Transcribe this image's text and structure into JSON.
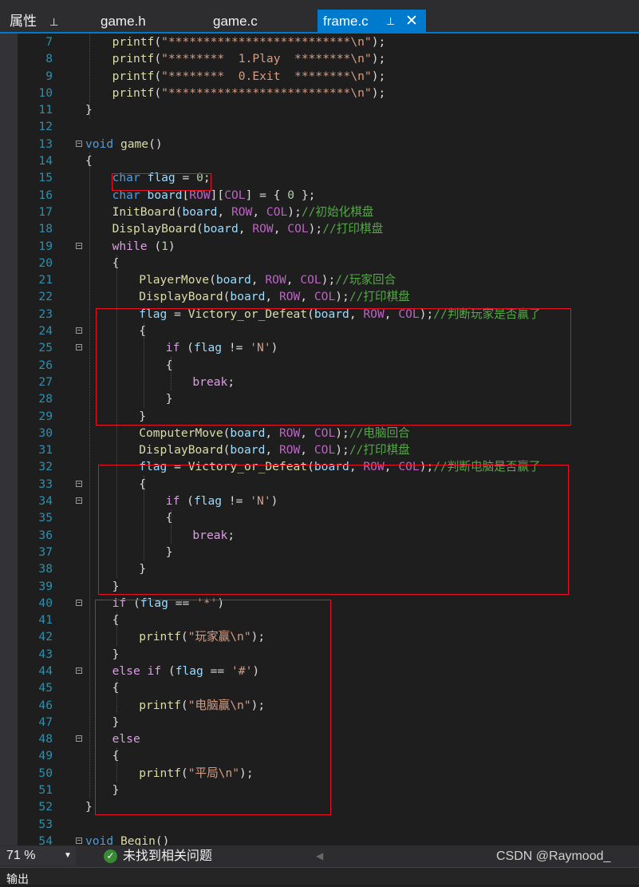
{
  "tabs": {
    "properties": "属性",
    "pin": "⊥",
    "game_h": "game.h",
    "game_c": "game.c",
    "frame_c": "frame.c",
    "close": "✕"
  },
  "code": [
    {
      "n": "7",
      "indent": 2,
      "t": [
        [
          "fn",
          "printf"
        ],
        [
          "p",
          "("
        ],
        [
          "s",
          "\"**************************\\n\""
        ],
        [
          "p",
          ");"
        ]
      ]
    },
    {
      "n": "8",
      "indent": 2,
      "t": [
        [
          "fn",
          "printf"
        ],
        [
          "p",
          "("
        ],
        [
          "s",
          "\"********  1.Play  ********\\n\""
        ],
        [
          "p",
          ");"
        ]
      ]
    },
    {
      "n": "9",
      "indent": 2,
      "t": [
        [
          "fn",
          "printf"
        ],
        [
          "p",
          "("
        ],
        [
          "s",
          "\"********  0.Exit  ********\\n\""
        ],
        [
          "p",
          ");"
        ]
      ]
    },
    {
      "n": "10",
      "indent": 2,
      "t": [
        [
          "fn",
          "printf"
        ],
        [
          "p",
          "("
        ],
        [
          "s",
          "\"**************************\\n\""
        ],
        [
          "p",
          ");"
        ]
      ]
    },
    {
      "n": "11",
      "indent": 0,
      "t": [
        [
          "p",
          "}"
        ]
      ]
    },
    {
      "n": "12",
      "indent": 0,
      "t": []
    },
    {
      "n": "13",
      "indent": 0,
      "fold": true,
      "t": [
        [
          "k",
          "void"
        ],
        [
          "p",
          " "
        ],
        [
          "fn",
          "game"
        ],
        [
          "p",
          "()"
        ]
      ]
    },
    {
      "n": "14",
      "indent": 0,
      "t": [
        [
          "p",
          "{"
        ]
      ]
    },
    {
      "n": "15",
      "indent": 2,
      "t": [
        [
          "k",
          "char"
        ],
        [
          "p",
          " "
        ],
        [
          "v",
          "flag"
        ],
        [
          "p",
          " = "
        ],
        [
          "n",
          "0"
        ],
        [
          "p",
          ";"
        ]
      ]
    },
    {
      "n": "16",
      "indent": 2,
      "t": [
        [
          "k",
          "char"
        ],
        [
          "p",
          " "
        ],
        [
          "v",
          "board"
        ],
        [
          "p",
          "["
        ],
        [
          "m",
          "ROW"
        ],
        [
          "p",
          "]["
        ],
        [
          "m",
          "COL"
        ],
        [
          "p",
          "] = { "
        ],
        [
          "n",
          "0"
        ],
        [
          "p",
          " };"
        ]
      ]
    },
    {
      "n": "17",
      "indent": 2,
      "t": [
        [
          "fn",
          "InitBoard"
        ],
        [
          "p",
          "("
        ],
        [
          "v",
          "board"
        ],
        [
          "p",
          ", "
        ],
        [
          "m",
          "ROW"
        ],
        [
          "p",
          ", "
        ],
        [
          "m",
          "COL"
        ],
        [
          "p",
          ");"
        ],
        [
          "c",
          "//初始化棋盘"
        ]
      ]
    },
    {
      "n": "18",
      "indent": 2,
      "t": [
        [
          "fn",
          "DisplayBoard"
        ],
        [
          "p",
          "("
        ],
        [
          "v",
          "board"
        ],
        [
          "p",
          ", "
        ],
        [
          "m",
          "ROW"
        ],
        [
          "p",
          ", "
        ],
        [
          "m",
          "COL"
        ],
        [
          "p",
          ");"
        ],
        [
          "c",
          "//打印棋盘"
        ]
      ]
    },
    {
      "n": "19",
      "indent": 2,
      "fold": true,
      "t": [
        [
          "k2",
          "while"
        ],
        [
          "p",
          " ("
        ],
        [
          "n",
          "1"
        ],
        [
          "p",
          ")"
        ]
      ]
    },
    {
      "n": "20",
      "indent": 2,
      "t": [
        [
          "p",
          "{"
        ]
      ]
    },
    {
      "n": "21",
      "indent": 4,
      "t": [
        [
          "fn",
          "PlayerMove"
        ],
        [
          "p",
          "("
        ],
        [
          "v",
          "board"
        ],
        [
          "p",
          ", "
        ],
        [
          "m",
          "ROW"
        ],
        [
          "p",
          ", "
        ],
        [
          "m",
          "COL"
        ],
        [
          "p",
          ");"
        ],
        [
          "c",
          "//玩家回合"
        ]
      ]
    },
    {
      "n": "22",
      "indent": 4,
      "t": [
        [
          "fn",
          "DisplayBoard"
        ],
        [
          "p",
          "("
        ],
        [
          "v",
          "board"
        ],
        [
          "p",
          ", "
        ],
        [
          "m",
          "ROW"
        ],
        [
          "p",
          ", "
        ],
        [
          "m",
          "COL"
        ],
        [
          "p",
          ");"
        ],
        [
          "c",
          "//打印棋盘"
        ]
      ]
    },
    {
      "n": "23",
      "indent": 4,
      "t": [
        [
          "v",
          "flag"
        ],
        [
          "p",
          " = "
        ],
        [
          "fn",
          "Victory_or_Defeat"
        ],
        [
          "p",
          "("
        ],
        [
          "v",
          "board"
        ],
        [
          "p",
          ", "
        ],
        [
          "m",
          "ROW"
        ],
        [
          "p",
          ", "
        ],
        [
          "m",
          "COL"
        ],
        [
          "p",
          ");"
        ],
        [
          "c",
          "//判断玩家是否赢了"
        ]
      ]
    },
    {
      "n": "24",
      "indent": 4,
      "fold": true,
      "t": [
        [
          "p",
          "{"
        ]
      ]
    },
    {
      "n": "25",
      "indent": 6,
      "fold": true,
      "t": [
        [
          "k2",
          "if"
        ],
        [
          "p",
          " ("
        ],
        [
          "v",
          "flag"
        ],
        [
          "p",
          " != "
        ],
        [
          "s",
          "'N'"
        ],
        [
          "p",
          ")"
        ]
      ]
    },
    {
      "n": "26",
      "indent": 6,
      "t": [
        [
          "p",
          "{"
        ]
      ]
    },
    {
      "n": "27",
      "indent": 8,
      "t": [
        [
          "k2",
          "break"
        ],
        [
          "p",
          ";"
        ]
      ]
    },
    {
      "n": "28",
      "indent": 6,
      "t": [
        [
          "p",
          "}"
        ]
      ]
    },
    {
      "n": "29",
      "indent": 4,
      "t": [
        [
          "p",
          "}"
        ]
      ]
    },
    {
      "n": "30",
      "indent": 4,
      "t": [
        [
          "fn",
          "ComputerMove"
        ],
        [
          "p",
          "("
        ],
        [
          "v",
          "board"
        ],
        [
          "p",
          ", "
        ],
        [
          "m",
          "ROW"
        ],
        [
          "p",
          ", "
        ],
        [
          "m",
          "COL"
        ],
        [
          "p",
          ");"
        ],
        [
          "c",
          "//电脑回合"
        ]
      ]
    },
    {
      "n": "31",
      "indent": 4,
      "t": [
        [
          "fn",
          "DisplayBoard"
        ],
        [
          "p",
          "("
        ],
        [
          "v",
          "board"
        ],
        [
          "p",
          ", "
        ],
        [
          "m",
          "ROW"
        ],
        [
          "p",
          ", "
        ],
        [
          "m",
          "COL"
        ],
        [
          "p",
          ");"
        ],
        [
          "c",
          "//打印棋盘"
        ]
      ]
    },
    {
      "n": "32",
      "indent": 4,
      "t": [
        [
          "v",
          "flag"
        ],
        [
          "p",
          " = "
        ],
        [
          "fn",
          "Victory_or_Defeat"
        ],
        [
          "p",
          "("
        ],
        [
          "v",
          "board"
        ],
        [
          "p",
          ", "
        ],
        [
          "m",
          "ROW"
        ],
        [
          "p",
          ", "
        ],
        [
          "m",
          "COL"
        ],
        [
          "p",
          ");"
        ],
        [
          "c",
          "//判断电脑是否赢了"
        ]
      ]
    },
    {
      "n": "33",
      "indent": 4,
      "fold": true,
      "t": [
        [
          "p",
          "{"
        ]
      ]
    },
    {
      "n": "34",
      "indent": 6,
      "fold": true,
      "t": [
        [
          "k2",
          "if"
        ],
        [
          "p",
          " ("
        ],
        [
          "v",
          "flag"
        ],
        [
          "p",
          " != "
        ],
        [
          "s",
          "'N'"
        ],
        [
          "p",
          ")"
        ]
      ]
    },
    {
      "n": "35",
      "indent": 6,
      "t": [
        [
          "p",
          "{"
        ]
      ]
    },
    {
      "n": "36",
      "indent": 8,
      "t": [
        [
          "k2",
          "break"
        ],
        [
          "p",
          ";"
        ]
      ]
    },
    {
      "n": "37",
      "indent": 6,
      "t": [
        [
          "p",
          "}"
        ]
      ]
    },
    {
      "n": "38",
      "indent": 4,
      "t": [
        [
          "p",
          "}"
        ]
      ]
    },
    {
      "n": "39",
      "indent": 2,
      "t": [
        [
          "p",
          "}"
        ]
      ]
    },
    {
      "n": "40",
      "indent": 2,
      "fold": true,
      "t": [
        [
          "k2",
          "if"
        ],
        [
          "p",
          " ("
        ],
        [
          "v",
          "flag"
        ],
        [
          "p",
          " == "
        ],
        [
          "s",
          "'*'"
        ],
        [
          "p",
          ")"
        ]
      ]
    },
    {
      "n": "41",
      "indent": 2,
      "t": [
        [
          "p",
          "{"
        ]
      ]
    },
    {
      "n": "42",
      "indent": 4,
      "t": [
        [
          "fn",
          "printf"
        ],
        [
          "p",
          "("
        ],
        [
          "s",
          "\"玩家赢\\n\""
        ],
        [
          "p",
          ");"
        ]
      ]
    },
    {
      "n": "43",
      "indent": 2,
      "t": [
        [
          "p",
          "}"
        ]
      ]
    },
    {
      "n": "44",
      "indent": 2,
      "fold": true,
      "t": [
        [
          "k2",
          "else if"
        ],
        [
          "p",
          " ("
        ],
        [
          "v",
          "flag"
        ],
        [
          "p",
          " == "
        ],
        [
          "s",
          "'#'"
        ],
        [
          "p",
          ")"
        ]
      ]
    },
    {
      "n": "45",
      "indent": 2,
      "t": [
        [
          "p",
          "{"
        ]
      ]
    },
    {
      "n": "46",
      "indent": 4,
      "t": [
        [
          "fn",
          "printf"
        ],
        [
          "p",
          "("
        ],
        [
          "s",
          "\"电脑赢\\n\""
        ],
        [
          "p",
          ");"
        ]
      ]
    },
    {
      "n": "47",
      "indent": 2,
      "t": [
        [
          "p",
          "}"
        ]
      ]
    },
    {
      "n": "48",
      "indent": 2,
      "fold": true,
      "t": [
        [
          "k2",
          "else"
        ]
      ]
    },
    {
      "n": "49",
      "indent": 2,
      "t": [
        [
          "p",
          "{"
        ]
      ]
    },
    {
      "n": "50",
      "indent": 4,
      "t": [
        [
          "fn",
          "printf"
        ],
        [
          "p",
          "("
        ],
        [
          "s",
          "\"平局\\n\""
        ],
        [
          "p",
          ");"
        ]
      ]
    },
    {
      "n": "51",
      "indent": 2,
      "t": [
        [
          "p",
          "}"
        ]
      ]
    },
    {
      "n": "52",
      "indent": 0,
      "t": [
        [
          "p",
          "}"
        ]
      ]
    },
    {
      "n": "53",
      "indent": 0,
      "t": []
    },
    {
      "n": "54",
      "indent": 0,
      "fold": true,
      "t": [
        [
          "k",
          "void"
        ],
        [
          "p",
          " "
        ],
        [
          "fn",
          "Begin"
        ],
        [
          "p",
          "()"
        ]
      ]
    }
  ],
  "statusbar": {
    "zoom": "71 %",
    "zoom_arrow": "▼",
    "check_icon": "✓",
    "message": "未找到相关问题",
    "scroll_arrow": "◀",
    "watermark": "CSDN @Raymood_"
  },
  "bottom_panel": {
    "title": "输出"
  },
  "colors": {
    "accent": "#007acc",
    "highlight_box": "#e81123",
    "background": "#1e1e1e"
  }
}
